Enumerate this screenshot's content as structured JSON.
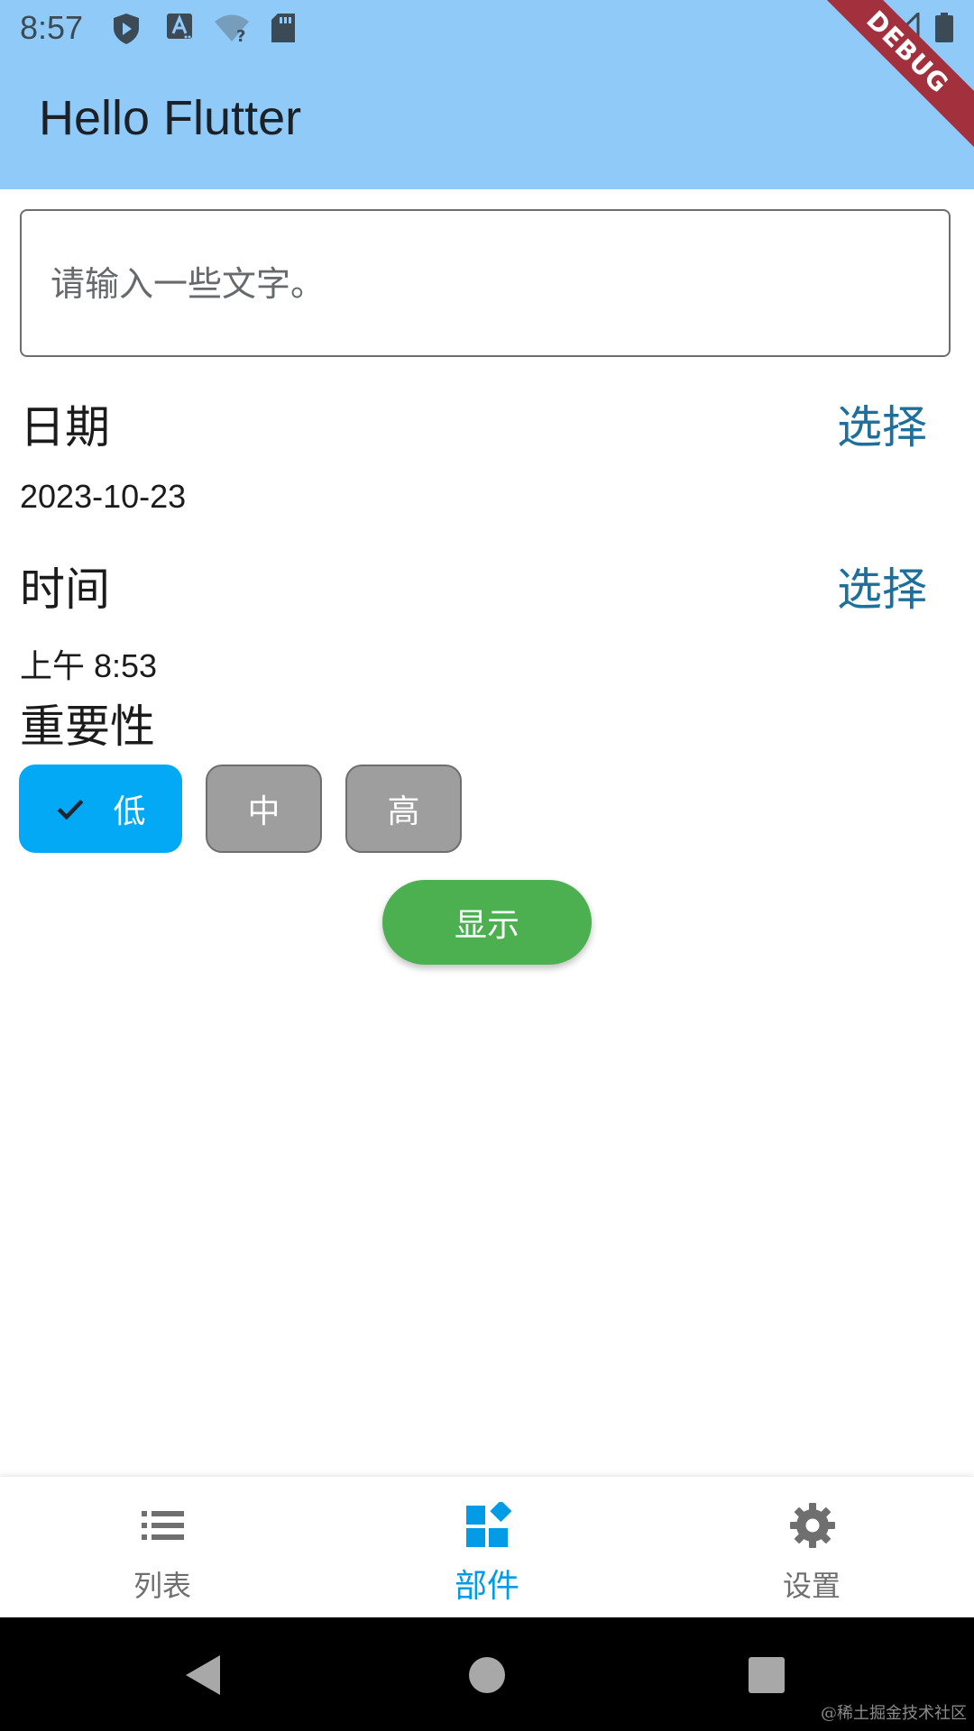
{
  "status_bar": {
    "time": "8:57",
    "icons": [
      "play-protect-icon",
      "font-a-icon",
      "wifi-question-icon",
      "sd-card-icon",
      "wifi-off-icon",
      "signal-icon",
      "battery-icon"
    ]
  },
  "app_bar": {
    "title": "Hello Flutter",
    "debug_banner": "DEBUG"
  },
  "form": {
    "text_input": {
      "value": "",
      "placeholder": "请输入一些文字。"
    },
    "date": {
      "label": "日期",
      "select_label": "选择",
      "value": "2023-10-23"
    },
    "time": {
      "label": "时间",
      "select_label": "选择",
      "value": "上午 8:53"
    },
    "importance": {
      "label": "重要性",
      "options": [
        {
          "label": "低",
          "selected": true
        },
        {
          "label": "中",
          "selected": false
        },
        {
          "label": "高",
          "selected": false
        }
      ]
    },
    "show_button_label": "显示"
  },
  "bottom_nav": {
    "items": [
      {
        "label": "列表",
        "icon": "list-icon",
        "active": false
      },
      {
        "label": "部件",
        "icon": "widgets-icon",
        "active": true
      },
      {
        "label": "设置",
        "icon": "settings-gear-icon",
        "active": false
      }
    ]
  },
  "system_nav": {
    "buttons": [
      "back-triangle-icon",
      "home-circle-icon",
      "recents-square-icon"
    ]
  },
  "watermark": "@稀土掘金技术社区",
  "colors": {
    "app_bar": "#90caf9",
    "chip_selected": "#03a9f4",
    "chip_unselected": "#9e9e9e",
    "show_button": "#4caf50",
    "link": "#1d6f9c",
    "nav_active": "#039be5",
    "nav_inactive": "#6f6f6f",
    "debug_ribbon": "#a3303d"
  }
}
